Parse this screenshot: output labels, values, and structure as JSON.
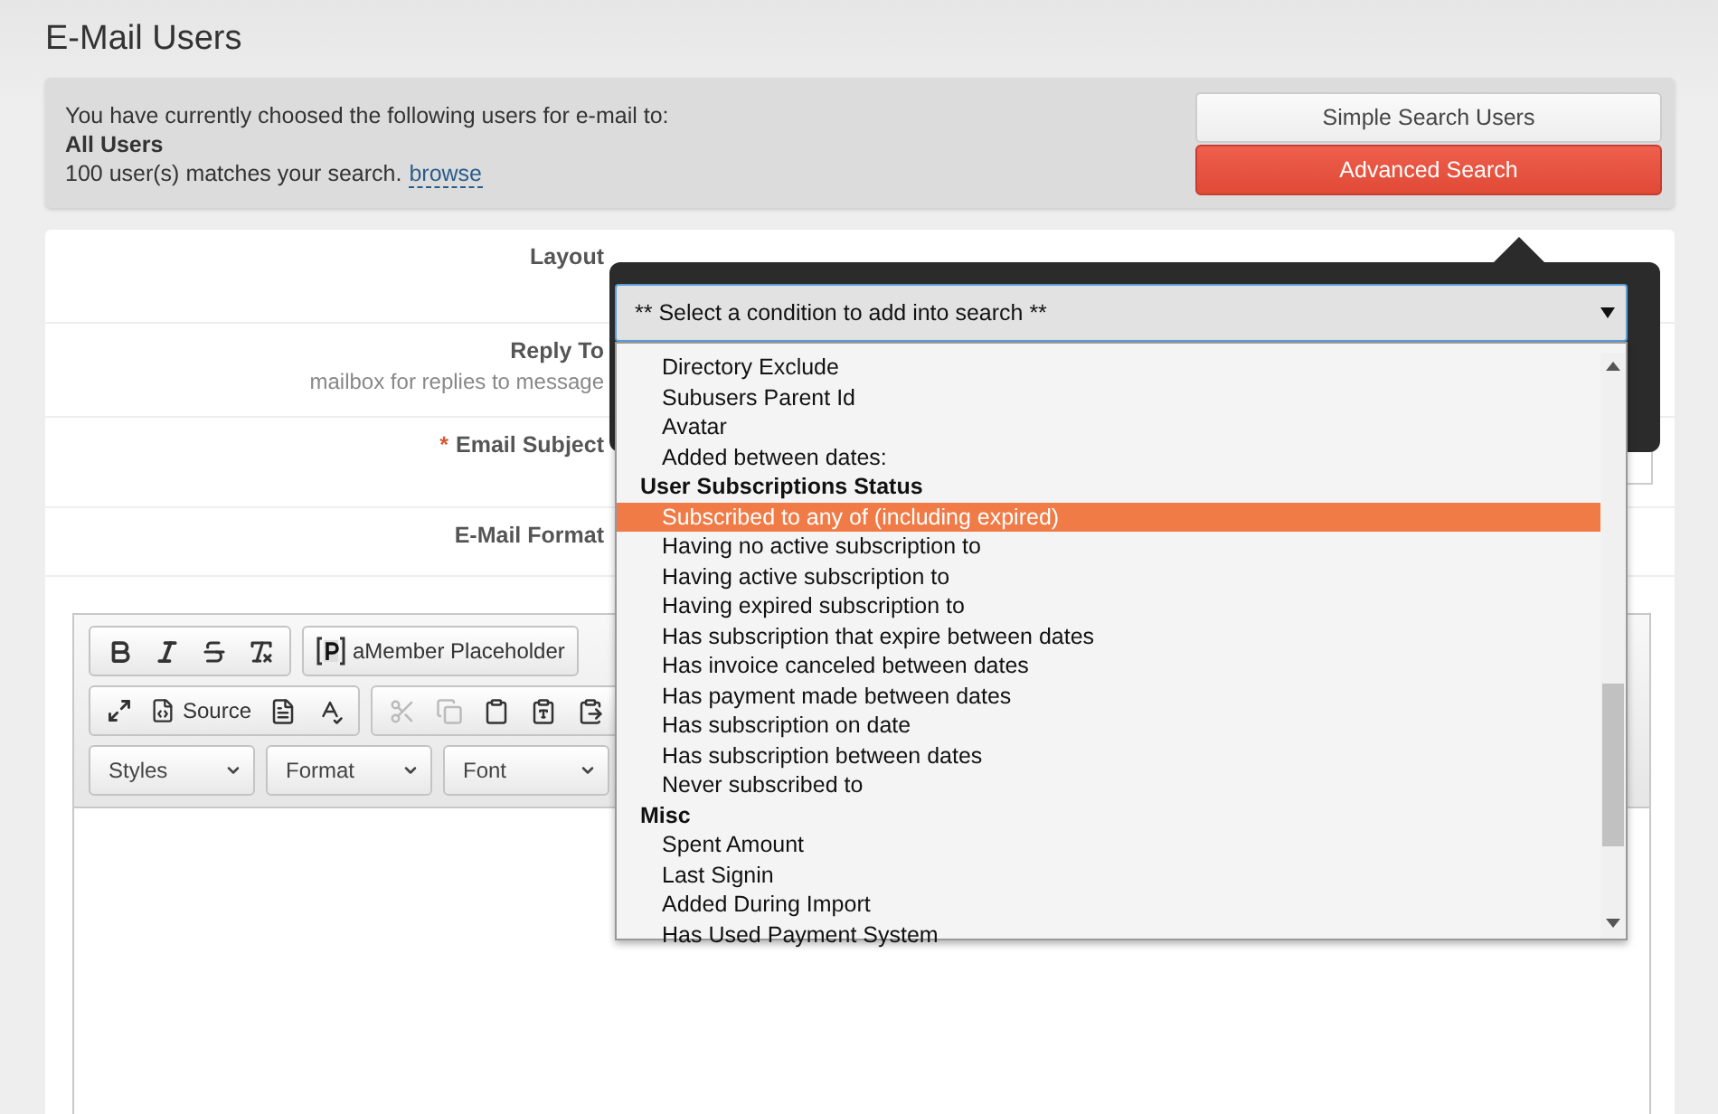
{
  "page": {
    "title": "E-Mail Users"
  },
  "selection_panel": {
    "intro": "You have currently choosed the following users for e-mail to:",
    "target": "All Users",
    "matches": "100 user(s) matches your search.",
    "browse_link": "browse",
    "buttons": [
      {
        "label": "Simple Search Users",
        "selected": false
      },
      {
        "label": "Advanced Search",
        "selected": true
      }
    ]
  },
  "form": {
    "rows": [
      {
        "label": "Layout",
        "kind": "plain"
      },
      {
        "label": "Reply To",
        "hint": "mailbox for replies to message",
        "kind": "plain"
      },
      {
        "label": "Email Subject",
        "required_mark": "*",
        "kind": "input"
      },
      {
        "label": "E-Mail Format",
        "kind": "plain"
      }
    ]
  },
  "editor": {
    "placeholder_button": "aMember Placeholder",
    "source_button": "Source",
    "clipboard": [
      {
        "disabled": true
      },
      {
        "disabled": true
      },
      {
        "disabled": false
      },
      {
        "disabled": false
      },
      {
        "disabled": false
      }
    ],
    "combos": [
      "Styles",
      "Format",
      "Font"
    ]
  },
  "condition_select": {
    "value": "** Select a condition to add into search **",
    "options": [
      {
        "kind": "option",
        "label": "Directory Exclude",
        "selected": false
      },
      {
        "kind": "option",
        "label": "Subusers Parent Id",
        "selected": false
      },
      {
        "kind": "option",
        "label": "Avatar",
        "selected": false
      },
      {
        "kind": "option",
        "label": "Added between dates:",
        "selected": false
      },
      {
        "kind": "group",
        "label": "User Subscriptions Status"
      },
      {
        "kind": "option",
        "label": "Subscribed to any of (including expired)",
        "selected": true
      },
      {
        "kind": "option",
        "label": "Having no active subscription to",
        "selected": false
      },
      {
        "kind": "option",
        "label": "Having active subscription to",
        "selected": false
      },
      {
        "kind": "option",
        "label": "Having expired subscription to",
        "selected": false
      },
      {
        "kind": "option",
        "label": "Has subscription that expire between dates",
        "selected": false
      },
      {
        "kind": "option",
        "label": "Has invoice canceled between dates",
        "selected": false
      },
      {
        "kind": "option",
        "label": "Has payment made between dates",
        "selected": false
      },
      {
        "kind": "option",
        "label": "Has subscription on date",
        "selected": false
      },
      {
        "kind": "option",
        "label": "Has subscription between dates",
        "selected": false
      },
      {
        "kind": "option",
        "label": "Never subscribed to",
        "selected": false
      },
      {
        "kind": "group",
        "label": "Misc"
      },
      {
        "kind": "option",
        "label": "Spent Amount",
        "selected": false
      },
      {
        "kind": "option",
        "label": "Last Signin",
        "selected": false
      },
      {
        "kind": "option",
        "label": "Added During Import",
        "selected": false
      },
      {
        "kind": "option",
        "label": "Has Used Payment System",
        "selected": false
      }
    ]
  }
}
